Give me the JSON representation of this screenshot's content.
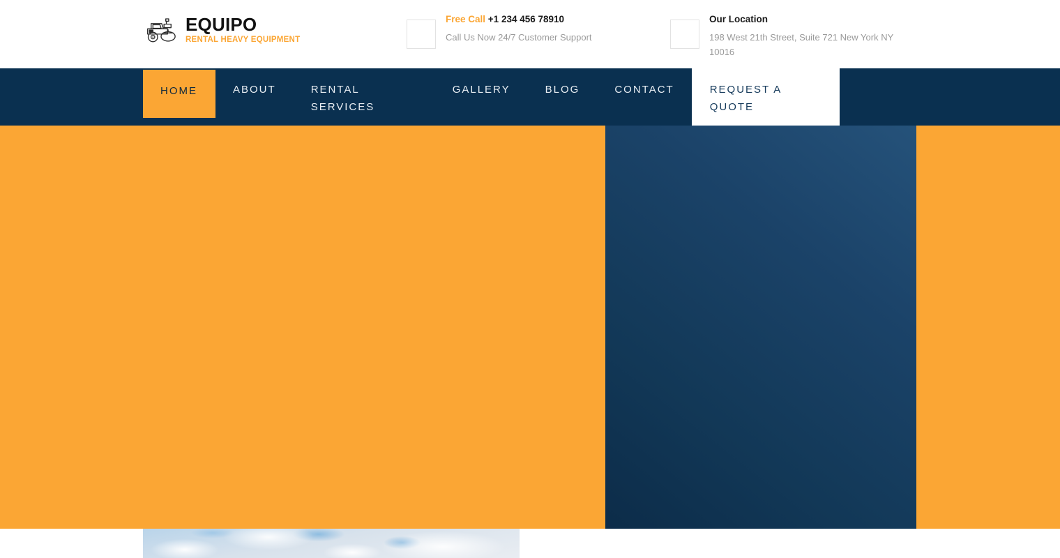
{
  "brand": {
    "logo_icon": "road-roller-icon",
    "name": "EQUIPO",
    "tagline": "RENTAL HEAVY EQUIPMENT"
  },
  "header": {
    "phone": {
      "icon": "phone-icon",
      "label": "Free Call",
      "number": "+1 234 456 78910",
      "subtitle": "Call Us Now 24/7 Customer Support"
    },
    "location": {
      "icon": "map-marker-icon",
      "label": "Our Location",
      "address": "198 West 21th Street, Suite 721 New York NY 10016"
    }
  },
  "nav": {
    "items": [
      {
        "label": "HOME",
        "active": true
      },
      {
        "label": "ABOUT",
        "active": false
      },
      {
        "label": "RENTAL SERVICES",
        "active": false
      },
      {
        "label": "GALLERY",
        "active": false
      },
      {
        "label": "BLOG",
        "active": false
      },
      {
        "label": "CONTACT",
        "active": false
      }
    ],
    "cta": {
      "label": "REQUEST A QUOTE"
    }
  },
  "hero": {
    "background_color": "#FBA634",
    "panel_color": "#1b4369"
  },
  "media": {
    "sky_image_alt": "sky-with-clouds-photo"
  },
  "colors": {
    "accent_orange": "#FBA634",
    "navy": "#0a3050",
    "panel_navy": "#1b4369",
    "muted_text": "#9a9a9a",
    "dark_text": "#1a1a1a"
  }
}
